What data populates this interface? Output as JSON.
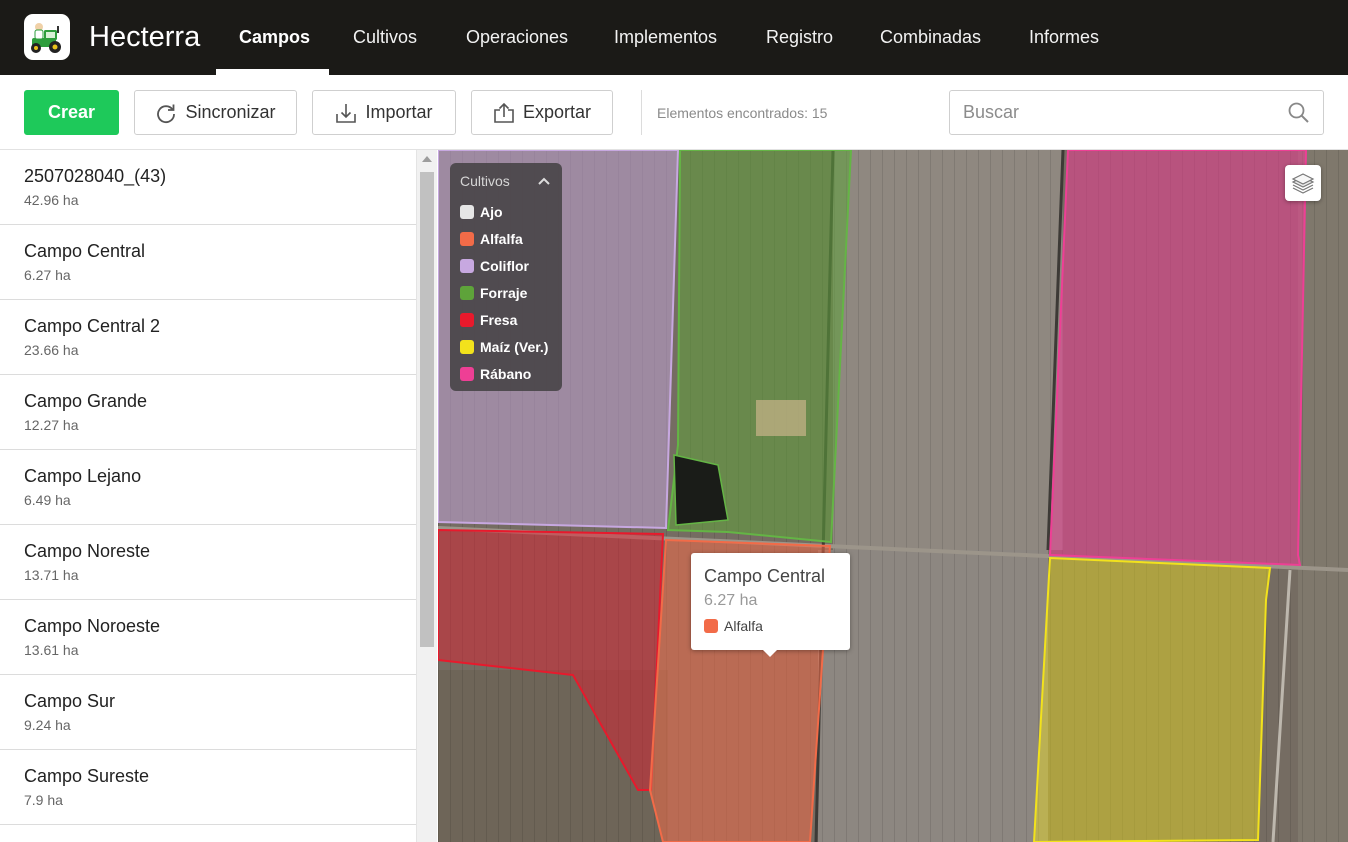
{
  "app": {
    "name": "Hecterra"
  },
  "nav": {
    "tabs": [
      {
        "label": "Campos",
        "active": true
      },
      {
        "label": "Cultivos"
      },
      {
        "label": "Operaciones"
      },
      {
        "label": "Implementos"
      },
      {
        "label": "Registro"
      },
      {
        "label": "Combinadas"
      },
      {
        "label": "Informes"
      }
    ]
  },
  "toolbar": {
    "create_label": "Crear",
    "sync_label": "Sincronizar",
    "import_label": "Importar",
    "export_label": "Exportar",
    "results_text": "Elementos encontrados: 15",
    "search_placeholder": "Buscar",
    "accent_color": "#1ec95a"
  },
  "fields": [
    {
      "name": "2507028040_(43)",
      "area": "42.96 ha"
    },
    {
      "name": "Campo Central",
      "area": "6.27 ha"
    },
    {
      "name": "Campo Central 2",
      "area": "23.66 ha"
    },
    {
      "name": "Campo Grande",
      "area": "12.27 ha"
    },
    {
      "name": "Campo Lejano",
      "area": "6.49 ha"
    },
    {
      "name": "Campo Noreste",
      "area": "13.71 ha"
    },
    {
      "name": "Campo Noroeste",
      "area": "13.61 ha"
    },
    {
      "name": "Campo Sur",
      "area": "9.24 ha"
    },
    {
      "name": "Campo Sureste",
      "area": "7.9 ha"
    }
  ],
  "legend": {
    "title": "Cultivos",
    "items": [
      {
        "label": "Ajo",
        "color": "#e6e6e6"
      },
      {
        "label": "Alfalfa",
        "color": "#f26b48"
      },
      {
        "label": "Coliflor",
        "color": "#c7a8e0"
      },
      {
        "label": "Forraje",
        "color": "#5ea33a"
      },
      {
        "label": "Fresa",
        "color": "#e8192c"
      },
      {
        "label": "Maíz (Ver.)",
        "color": "#f2e21c"
      },
      {
        "label": "Rábano",
        "color": "#ee3f95"
      }
    ]
  },
  "popup": {
    "title": "Campo Central",
    "area": "6.27 ha",
    "crop": "Alfalfa",
    "crop_color": "#f26b48"
  }
}
